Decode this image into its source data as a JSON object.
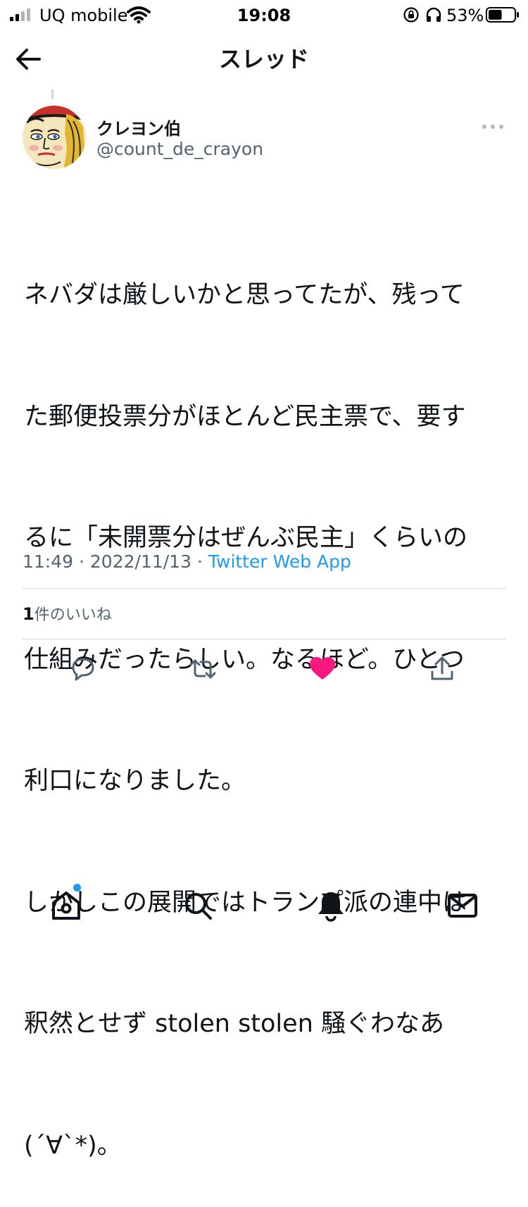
{
  "status_bar": {
    "carrier": "UQ mobile",
    "time": "19:08",
    "battery_percent": "53%",
    "battery_level": 0.53,
    "icons": [
      "signal-icon",
      "wifi-icon",
      "rotation-lock-icon",
      "headphones-icon",
      "battery-icon"
    ]
  },
  "header": {
    "title": "スレッド",
    "back_icon": "back-arrow-icon"
  },
  "tweet": {
    "author": {
      "display_name": "クレヨン伯",
      "handle": "@count_de_crayon"
    },
    "body_lines": [
      "ネバダは厳しいかと思ってたが、残って",
      "た郵便投票分がほとんど民主票で、要す",
      "るに「未開票分はぜんぶ民主」くらいの",
      "仕組みだったらしい。なるほど。ひとつ",
      "利口になりました。",
      "しかしこの展開ではトランプ派の連中は",
      "釈然とせず stolen stolen 騒ぐわなあ",
      "(´∀`*)。"
    ],
    "time": "11:49",
    "date": "2022/11/13",
    "separator": "·",
    "source": "Twitter Web App",
    "likes_count": "1",
    "likes_label": "件のいいね",
    "liked": true
  },
  "actions": [
    "reply-icon",
    "retweet-icon",
    "heart-icon",
    "share-icon"
  ],
  "tab_bar": [
    "home-icon",
    "search-icon",
    "notifications-icon",
    "messages-icon"
  ],
  "colors": {
    "accent": "#1d9bf0",
    "like": "#f91880",
    "secondary_text": "#536471",
    "divider": "#cfd9de",
    "home_badge": "#1d9bf0"
  }
}
